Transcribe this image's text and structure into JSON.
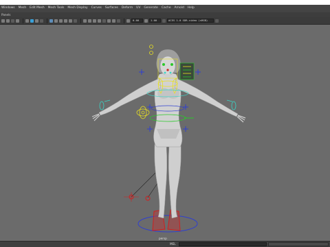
{
  "menubar": {
    "items": [
      "Windows",
      "Mesh",
      "Edit Mesh",
      "Mesh Tools",
      "Mesh Display",
      "Curves",
      "Surfaces",
      "Deform",
      "UV",
      "Generate",
      "Cache",
      "Arnold",
      "Help"
    ]
  },
  "panels": {
    "label": "Panels"
  },
  "toolbar": {
    "field_value_1": "0.00",
    "field_value_2": "1.00",
    "colorspace": "ACES 1.0 SDR-video (sRGB)"
  },
  "viewport": {
    "camera_label": "persp"
  },
  "command_line": {
    "language": "MEL"
  },
  "colors": {
    "viewport_bg": "#6b6b6b",
    "controller_blue": "#2f3fd0",
    "controller_yellow": "#e8e020",
    "controller_green": "#2ac92a",
    "controller_cyan": "#38d7c8",
    "controller_red": "#d02020"
  }
}
